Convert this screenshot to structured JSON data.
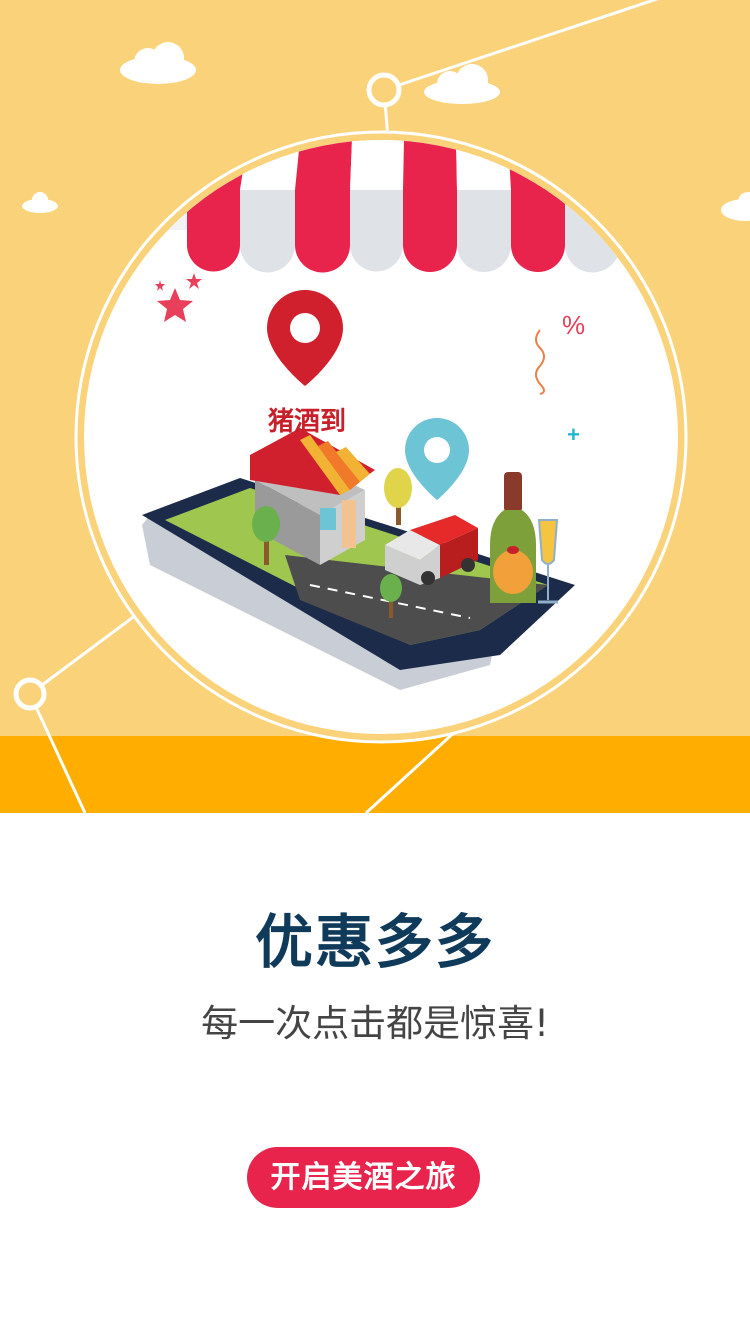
{
  "hero": {
    "store_sign": "猪酒到",
    "percent_symbol": "%",
    "plus_symbol": "+",
    "colors": {
      "background": "#f9d27a",
      "band": "#ffad00",
      "awning_red": "#e8244d",
      "pin_red": "#d0202d",
      "pin_teal": "#6cc4d4"
    }
  },
  "content": {
    "title": "优惠多多",
    "subtitle": "每一次点击都是惊喜!",
    "cta_label": "开启美酒之旅"
  }
}
